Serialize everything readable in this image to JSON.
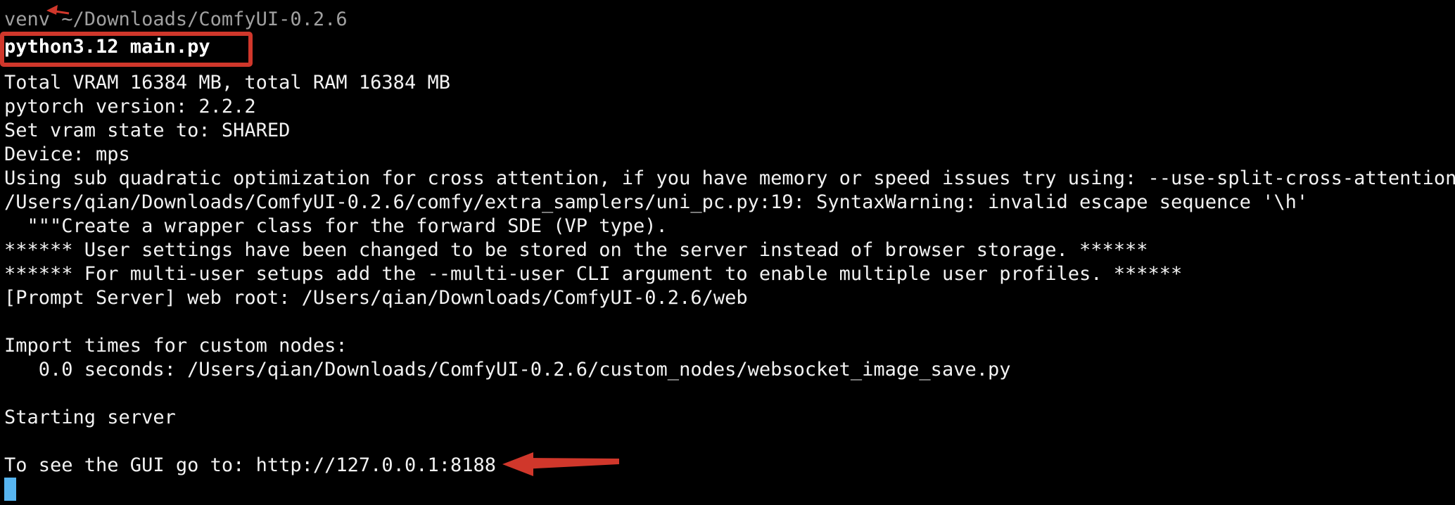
{
  "terminal": {
    "prompt": "venv ~/Downloads/ComfyUI-0.2.6",
    "command": "python3.12 main.py",
    "output": [
      "Total VRAM 16384 MB, total RAM 16384 MB",
      "pytorch version: 2.2.2",
      "Set vram state to: SHARED",
      "Device: mps",
      "Using sub quadratic optimization for cross attention, if you have memory or speed issues try using: --use-split-cross-attention",
      "/Users/qian/Downloads/ComfyUI-0.2.6/comfy/extra_samplers/uni_pc.py:19: SyntaxWarning: invalid escape sequence '\\h'",
      "  \"\"\"Create a wrapper class for the forward SDE (VP type).",
      "****** User settings have been changed to be stored on the server instead of browser storage. ******",
      "****** For multi-user setups add the --multi-user CLI argument to enable multiple user profiles. ******",
      "[Prompt Server] web root: /Users/qian/Downloads/ComfyUI-0.2.6/web",
      "",
      "Import times for custom nodes:",
      "   0.0 seconds: /Users/qian/Downloads/ComfyUI-0.2.6/custom_nodes/websocket_image_save.py",
      "",
      "Starting server",
      "",
      "To see the GUI go to: http://127.0.0.1:8188"
    ]
  },
  "annotations": {
    "color": "#d0372b"
  },
  "colors": {
    "background": "#000000",
    "text": "#f2f2f2",
    "prompt": "#a0a0a0",
    "cursor": "#57b5f0"
  }
}
